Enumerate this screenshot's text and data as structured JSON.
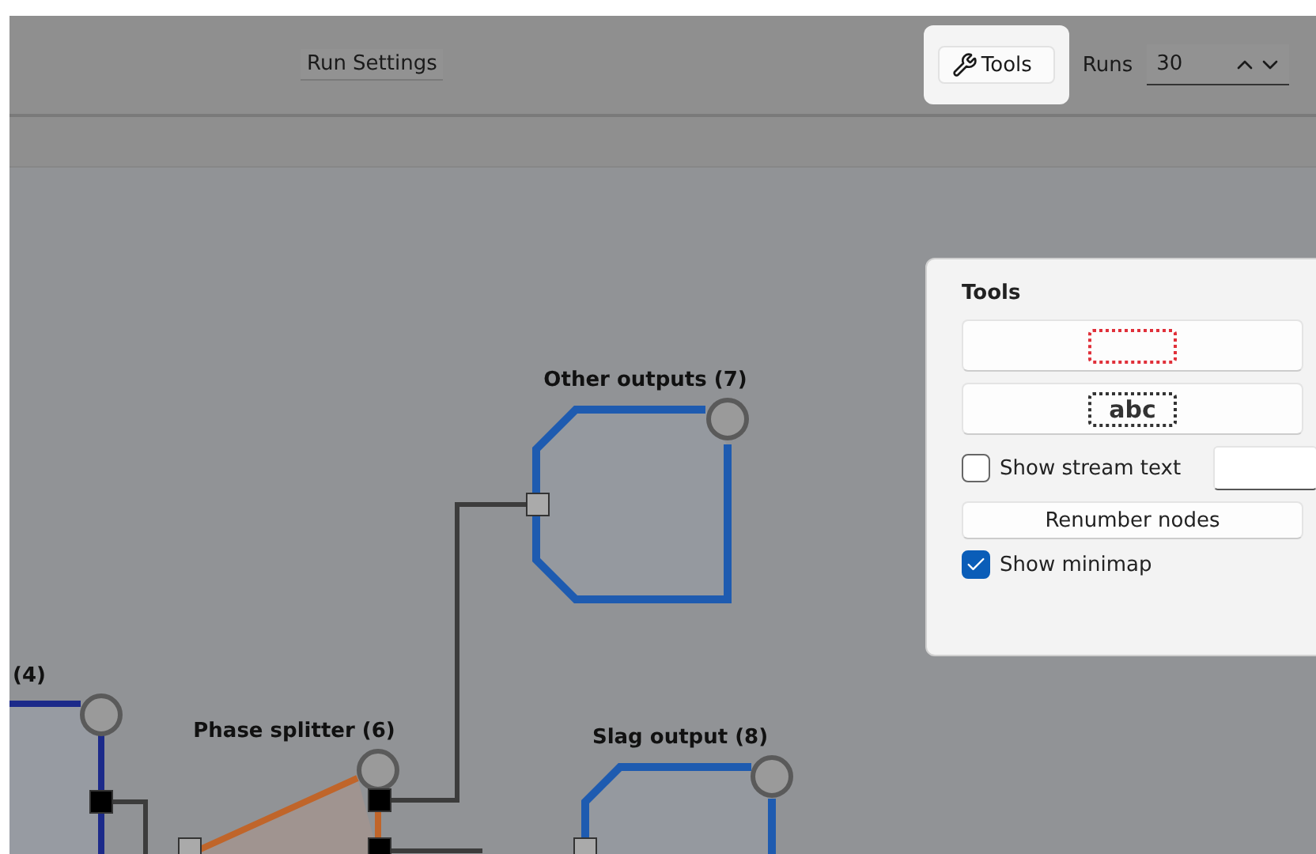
{
  "toolbar": {
    "run_settings": "Run Settings",
    "tools": {
      "label": "Tools",
      "highlighted": true
    },
    "runs": {
      "label": "Runs",
      "value": "30"
    }
  },
  "canvas": {
    "nodes": [
      {
        "label": "Other outputs (7)",
        "kind": "octagon",
        "color": "#1e5bb0"
      },
      {
        "label": "(4)",
        "kind": "mixer",
        "color": "#1c2a8a"
      },
      {
        "label": "Phase splitter (6)",
        "kind": "splitter",
        "color": "#c0652a"
      },
      {
        "label": "Slag output (8)",
        "kind": "outlet",
        "color": "#1e5bb0"
      }
    ]
  },
  "tools_panel": {
    "title": "Tools",
    "text_tool": "abc",
    "show_stream_text": {
      "label": "Show stream text",
      "checked": false
    },
    "renumber": "Renumber nodes",
    "show_minimap": {
      "label": "Show minimap",
      "checked": true
    }
  }
}
